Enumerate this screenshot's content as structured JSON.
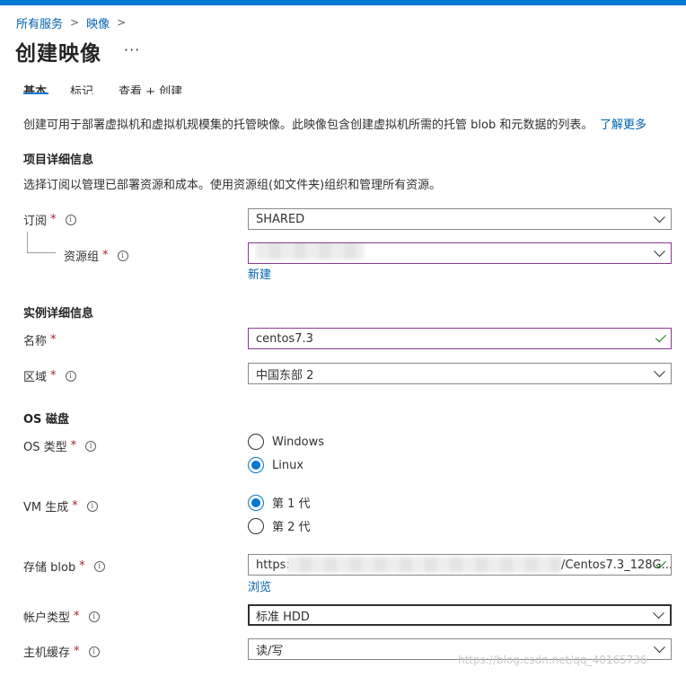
{
  "breadcrumb": {
    "item1": "所有服务",
    "item2": "映像"
  },
  "page": {
    "title": "创建映像",
    "more": "···"
  },
  "tabs": {
    "basics": "基本",
    "tags": "标记",
    "review": "查看 + 创建"
  },
  "intro": {
    "description": "创建可用于部署虚拟机和虚拟机规模集的托管映像。此映像包含创建虚拟机所需的托管 blob 和元数据的列表。",
    "learn_more": "了解更多"
  },
  "project": {
    "title": "项目详细信息",
    "description": "选择订阅以管理已部署资源和成本。使用资源组(如文件夹)组织和管理所有资源。",
    "subscription_label": "订阅",
    "subscription_value": "SHARED",
    "resource_group_label": "资源组",
    "resource_group_value": "",
    "create_new": "新建"
  },
  "instance": {
    "title": "实例详细信息",
    "name_label": "名称",
    "name_value": "centos7.3",
    "region_label": "区域",
    "region_value": "中国东部 2"
  },
  "os_disk": {
    "title": "OS 磁盘",
    "os_type_label": "OS 类型",
    "os_windows": "Windows",
    "os_linux": "Linux",
    "os_selected": "Linux",
    "vm_gen_label": "VM 生成",
    "gen1": "第 1 代",
    "gen2": "第 2 代",
    "gen_selected": "第 1 代",
    "storage_blob_label": "存储 blob",
    "storage_blob_prefix": "https:",
    "storage_blob_suffix": "/Centos7.3_128G...",
    "browse": "浏览",
    "account_type_label": "帐户类型",
    "account_type_value": "标准 HDD",
    "host_cache_label": "主机缓存",
    "host_cache_value": "读/写"
  },
  "watermark": "https://blog.csdn.net/qq_40165736",
  "colors": {
    "accent": "#0078d4",
    "link": "#0062ad",
    "required": "#a4262c",
    "valid": "#107c10",
    "modified_border": "#8c3b8f"
  }
}
